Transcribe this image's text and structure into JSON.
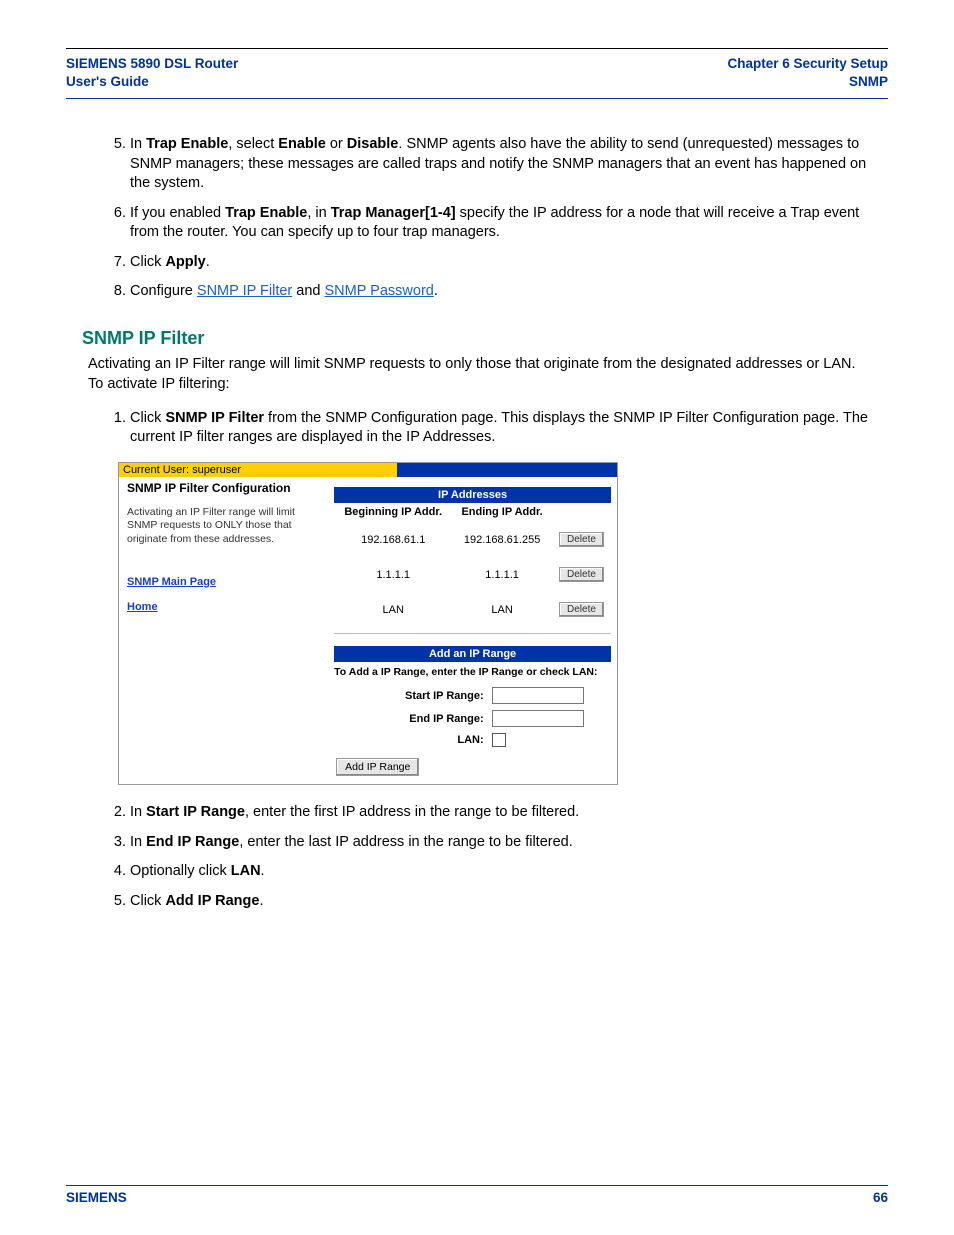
{
  "header": {
    "left_line1": "SIEMENS 5890 DSL Router",
    "left_line2": "User's Guide",
    "right_line1": "Chapter 6  Security Setup",
    "right_line2": "SNMP"
  },
  "steps_top": {
    "s5_pre": "In ",
    "s5_b1": "Trap Enable",
    "s5_mid1": ", select ",
    "s5_b2": "Enable",
    "s5_mid2": " or ",
    "s5_b3": "Disable",
    "s5_post": ". SNMP agents also have the ability to send (unrequested) messages to SNMP managers; these messages are called traps and notify the SNMP managers that an event has happened on the system.",
    "s6_pre": "If you enabled ",
    "s6_b1": "Trap Enable",
    "s6_mid1": ", in ",
    "s6_b2": "Trap Manager[1-4]",
    "s6_post": " specify the IP address for a node that will receive a Trap event from the router. You can specify up to four trap managers.",
    "s7_pre": "Click ",
    "s7_b1": "Apply",
    "s7_post": ".",
    "s8_pre": "Configure ",
    "s8_l1": "SNMP IP Filter",
    "s8_mid": " and ",
    "s8_l2": "SNMP Password",
    "s8_post": "."
  },
  "section": {
    "title": "SNMP IP Filter",
    "intro": "Activating an IP Filter range will limit SNMP requests to only those that originate from the designated addresses or LAN. To activate IP filtering:",
    "s1_pre": "Click ",
    "s1_b1": "SNMP IP Filter",
    "s1_post": " from the SNMP Configuration page. This displays the SNMP IP Filter Configuration page. The current IP filter ranges are displayed in the IP Addresses."
  },
  "screenshot": {
    "current_user": "Current User: superuser",
    "cfg_title": "SNMP IP Filter Configuration",
    "desc": "Activating an IP Filter range will limit SNMP requests to ONLY those that originate from these addresses.",
    "link_main": "SNMP Main Page",
    "link_home": "Home",
    "ip_hdr": "IP Addresses",
    "col1": "Beginning IP Addr.",
    "col2": "Ending IP Addr.",
    "rows": [
      {
        "b": "192.168.61.1",
        "e": "192.168.61.255",
        "btn": "Delete"
      },
      {
        "b": "1.1.1.1",
        "e": "1.1.1.1",
        "btn": "Delete"
      },
      {
        "b": "LAN",
        "e": "LAN",
        "btn": "Delete"
      }
    ],
    "add_hdr": "Add an IP Range",
    "add_note": "To Add a IP Range, enter the IP Range or check LAN:",
    "lbl_start": "Start IP Range:",
    "lbl_end": "End IP Range:",
    "lbl_lan": "LAN:",
    "add_btn": "Add IP Range"
  },
  "steps_bottom": {
    "s2_pre": "In ",
    "s2_b1": "Start IP Range",
    "s2_post": ", enter the first IP address in the range to be filtered.",
    "s3_pre": "In ",
    "s3_b1": "End IP Range",
    "s3_post": ", enter the last IP address in the range to be filtered.",
    "s4_pre": "Optionally click ",
    "s4_b1": "LAN",
    "s4_post": ".",
    "s5_pre": "Click ",
    "s5_b1": "Add IP Range",
    "s5_post": "."
  },
  "footer": {
    "left": "SIEMENS",
    "right": "66"
  }
}
